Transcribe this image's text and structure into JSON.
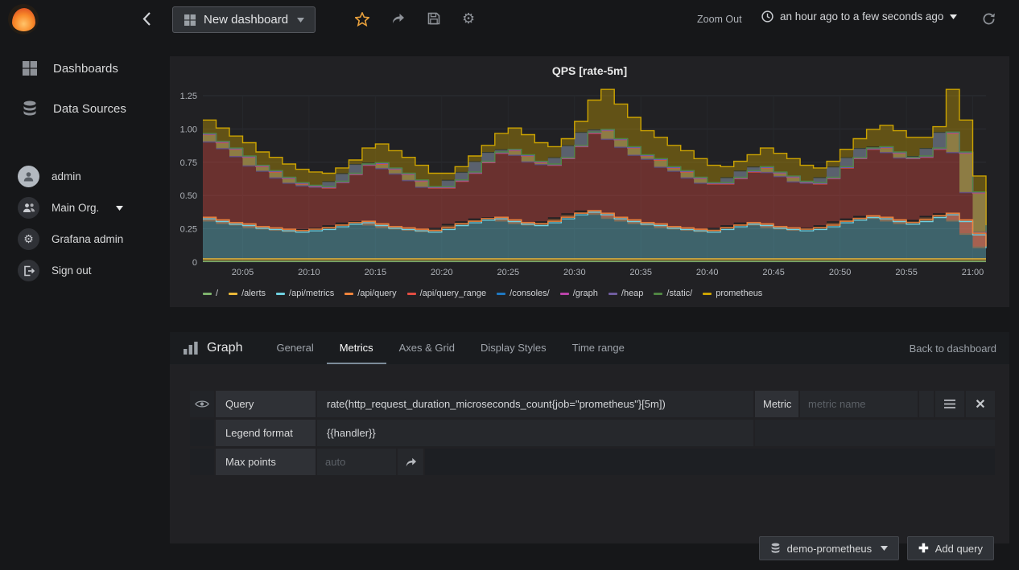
{
  "topnav": {
    "dashboard_button": "New dashboard",
    "zoom_out": "Zoom Out",
    "time_range": "an hour ago to a few seconds ago"
  },
  "sidebar": {
    "items": [
      {
        "label": "Dashboards"
      },
      {
        "label": "Data Sources"
      }
    ],
    "profile": [
      {
        "label": "admin"
      },
      {
        "label": "Main Org."
      },
      {
        "label": "Grafana admin"
      },
      {
        "label": "Sign out"
      }
    ]
  },
  "chart_data": {
    "type": "area",
    "stacked": true,
    "title": "QPS [rate-5m]",
    "ylim": [
      0,
      1.25
    ],
    "grid": true,
    "legend_position": "bottom",
    "y_ticks": [
      {
        "v": 0,
        "label": "0"
      },
      {
        "v": 0.25,
        "label": "0.25"
      },
      {
        "v": 0.5,
        "label": "0.50"
      },
      {
        "v": 0.75,
        "label": "0.75"
      },
      {
        "v": 1.0,
        "label": "1.00"
      },
      {
        "v": 1.25,
        "label": "1.25"
      }
    ],
    "x_tick_labels": [
      "20:05",
      "20:10",
      "20:15",
      "20:20",
      "20:25",
      "20:30",
      "20:35",
      "20:40",
      "20:45",
      "20:50",
      "20:55",
      "21:00"
    ],
    "x_tick_indices": [
      3,
      8,
      13,
      18,
      23,
      28,
      33,
      38,
      43,
      48,
      53,
      58
    ],
    "series": [
      {
        "name": "/",
        "color": "#7EB26D",
        "values": [
          0.005
        ]
      },
      {
        "name": "/alerts",
        "color": "#EAB839",
        "values": [
          0.02
        ]
      },
      {
        "name": "/api/metrics",
        "color": "#6ED0E0",
        "values": [
          0.3,
          0.28,
          0.26,
          0.25,
          0.23,
          0.22,
          0.21,
          0.2,
          0.21,
          0.22,
          0.24,
          0.26,
          0.27,
          0.25,
          0.23,
          0.22,
          0.21,
          0.2,
          0.22,
          0.25,
          0.27,
          0.29,
          0.3,
          0.28,
          0.26,
          0.25,
          0.27,
          0.3,
          0.33,
          0.35,
          0.33,
          0.3,
          0.28,
          0.26,
          0.25,
          0.23,
          0.22,
          0.21,
          0.2,
          0.22,
          0.24,
          0.26,
          0.25,
          0.23,
          0.22,
          0.21,
          0.22,
          0.24,
          0.27,
          0.29,
          0.31,
          0.3,
          0.28,
          0.26,
          0.28,
          0.31,
          0.33,
          0.28,
          0.18,
          0.08
        ]
      },
      {
        "name": "/api/query",
        "color": "#EF843C",
        "values": [
          0.012
        ]
      },
      {
        "name": "/api/query_range",
        "color": "#E24D42",
        "values": [
          0.62,
          0.58,
          0.55,
          0.5,
          0.45,
          0.42,
          0.38,
          0.35,
          0.32,
          0.3,
          0.32,
          0.36,
          0.42,
          0.45,
          0.43,
          0.4,
          0.36,
          0.32,
          0.3,
          0.32,
          0.36,
          0.42,
          0.48,
          0.52,
          0.5,
          0.46,
          0.42,
          0.44,
          0.5,
          0.58,
          0.62,
          0.58,
          0.54,
          0.5,
          0.48,
          0.44,
          0.42,
          0.38,
          0.35,
          0.33,
          0.35,
          0.38,
          0.42,
          0.4,
          0.38,
          0.35,
          0.33,
          0.35,
          0.4,
          0.45,
          0.5,
          0.52,
          0.5,
          0.48,
          0.47,
          0.5,
          0.6,
          0.5,
          0.3,
          0.1
        ]
      },
      {
        "name": "/consoles/",
        "color": "#1F78C1",
        "values": [
          0.004
        ]
      },
      {
        "name": "/graph",
        "color": "#BA43A9",
        "values": [
          0.002
        ]
      },
      {
        "name": "/heap",
        "color": "#705DA0",
        "values": [
          0.002
        ]
      },
      {
        "name": "/static/",
        "color": "#508642",
        "values": [
          0.002
        ]
      },
      {
        "name": "prometheus",
        "color": "#CCA300",
        "values": [
          0.1,
          0.1,
          0.09,
          0.1,
          0.1,
          0.1,
          0.1,
          0.1,
          0.1,
          0.1,
          0.1,
          0.1,
          0.12,
          0.14,
          0.13,
          0.12,
          0.11,
          0.1,
          0.1,
          0.1,
          0.12,
          0.12,
          0.14,
          0.16,
          0.15,
          0.14,
          0.13,
          0.14,
          0.18,
          0.24,
          0.3,
          0.26,
          0.22,
          0.18,
          0.16,
          0.16,
          0.15,
          0.14,
          0.13,
          0.12,
          0.12,
          0.12,
          0.14,
          0.14,
          0.13,
          0.12,
          0.11,
          0.12,
          0.13,
          0.14,
          0.14,
          0.16,
          0.16,
          0.15,
          0.14,
          0.16,
          0.32,
          0.24,
          0.12,
          0.05
        ]
      }
    ]
  },
  "editor": {
    "title": "Graph",
    "tabs": [
      "General",
      "Metrics",
      "Axes & Grid",
      "Display Styles",
      "Time range"
    ],
    "active_tab": "Metrics",
    "back_link": "Back to dashboard",
    "rows": {
      "query_label": "Query",
      "query_value": "rate(http_request_duration_microseconds_count{job=\"prometheus\"}[5m])",
      "metric_label": "Metric",
      "metric_placeholder": "metric name",
      "legend_label": "Legend format",
      "legend_value": "{{handler}}",
      "maxpoints_label": "Max points",
      "maxpoints_placeholder": "auto"
    },
    "datasource_button": "demo-prometheus",
    "add_query_button": "Add query"
  }
}
